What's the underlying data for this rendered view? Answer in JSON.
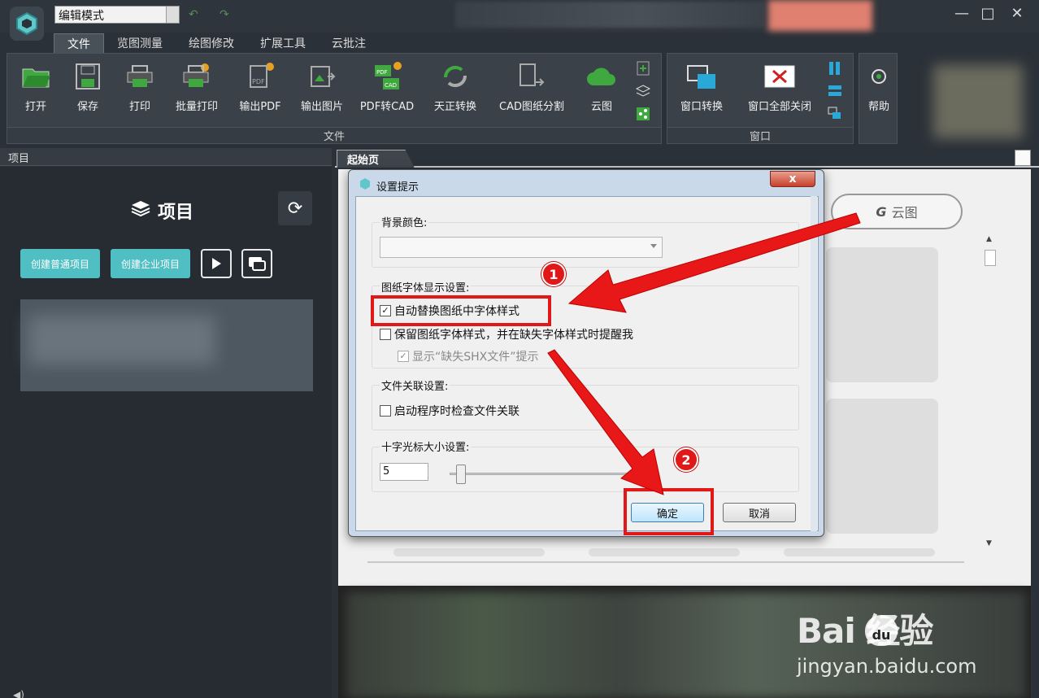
{
  "app": {
    "mode": "编辑模式"
  },
  "menu_tabs": [
    "文件",
    "览图测量",
    "绘图修改",
    "扩展工具",
    "云批注"
  ],
  "ribbon": {
    "file_buttons": [
      "打开",
      "保存",
      "打印",
      "批量打印",
      "输出PDF",
      "输出图片",
      "PDF转CAD",
      "天正转换",
      "CAD图纸分割",
      "云图"
    ],
    "file_group_label": "文件",
    "window_buttons": [
      "窗口转换",
      "窗口全部关闭"
    ],
    "window_group_label": "窗口",
    "help_label": "帮助"
  },
  "left_panel": {
    "header": "项目",
    "title": "项目",
    "create_normal": "创建普通项目",
    "create_enterprise": "创建企业项目"
  },
  "tabs": {
    "start": "起始页"
  },
  "cloud_button": "云图",
  "dialog": {
    "title": "设置提示",
    "close": "x",
    "bg_color_label": "背景颜色:",
    "bg_color_value": "",
    "font_section": "图纸字体显示设置:",
    "opt_auto_replace": "自动替换图纸中字体样式",
    "opt_keep_style": "保留图纸字体样式，并在缺失字体样式时提醒我",
    "opt_show_missing": "显示“缺失SHX文件”提示",
    "file_assoc_section": "文件关联设置:",
    "opt_check_assoc": "启动程序时检查文件关联",
    "crosshair_section": "十字光标大小设置:",
    "crosshair_value": "5",
    "ok": "确定",
    "cancel": "取消"
  },
  "annotations": {
    "step1": "1",
    "step2": "2"
  },
  "watermark": {
    "main": "Bai 经验",
    "du": "du",
    "sub": "jingyan.baidu.com"
  },
  "colors": {
    "accent_teal": "#4fbfc4",
    "highlight_red": "#e01818",
    "dialog_frame": "#c9d9ea"
  }
}
